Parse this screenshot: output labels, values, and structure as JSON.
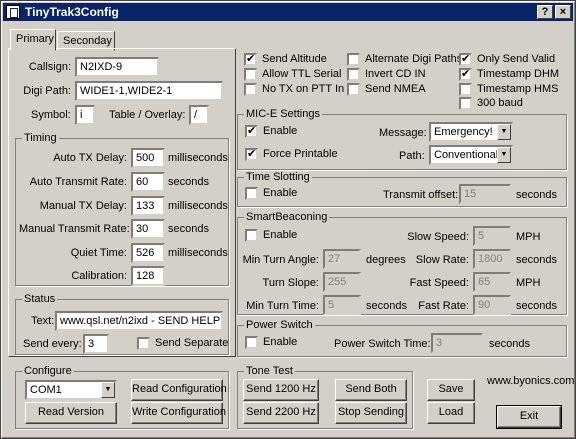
{
  "window": {
    "title": "TinyTrak3Config",
    "help": "?",
    "close": "×"
  },
  "tabs": [
    "Primary",
    "Seconday"
  ],
  "primary": {
    "callsign_label": "Callsign:",
    "callsign": "N2IXD-9",
    "digipath_label": "Digi Path:",
    "digipath": "WIDE1-1,WIDE2-1",
    "symbol_label": "Symbol:",
    "symbol": "i",
    "table_label": "Table / Overlay:",
    "table": "/"
  },
  "timing": {
    "title": "Timing",
    "rows": [
      {
        "label": "Auto TX Delay:",
        "value": "500",
        "unit": "milliseconds"
      },
      {
        "label": "Auto Transmit Rate:",
        "value": "60",
        "unit": "seconds"
      },
      {
        "label": "Manual TX Delay:",
        "value": "133",
        "unit": "milliseconds"
      },
      {
        "label": "Manual Transmit Rate:",
        "value": "30",
        "unit": "seconds"
      },
      {
        "label": "Quiet Time:",
        "value": "526",
        "unit": "milliseconds"
      },
      {
        "label": "Calibration:",
        "value": "128",
        "unit": ""
      }
    ]
  },
  "status": {
    "title": "Status",
    "text_label": "Text:",
    "text": "www.qsl.net/n2ixd - SEND HELP",
    "every_label": "Send every:",
    "every": "3",
    "separate": "Send Separate"
  },
  "checks": [
    {
      "label": "Send Altitude",
      "on": true
    },
    {
      "label": "Alternate Digi Paths",
      "on": false
    },
    {
      "label": "Only Send Valid",
      "on": true
    },
    {
      "label": "Allow TTL Serial",
      "on": false
    },
    {
      "label": "Invert CD IN",
      "on": false
    },
    {
      "label": "Timestamp DHM",
      "on": true
    },
    {
      "label": "No TX on PTT In",
      "on": false
    },
    {
      "label": "Send NMEA",
      "on": false
    },
    {
      "label": "Timestamp HMS",
      "on": false
    },
    {
      "label": "300 baud",
      "on": false
    }
  ],
  "mice": {
    "title": "MIC-E Settings",
    "enable": "Enable",
    "force": "Force Printable",
    "message_label": "Message:",
    "message": "Emergency!",
    "path_label": "Path:",
    "path": "Conventional"
  },
  "slotting": {
    "title": "Time Slotting",
    "enable": "Enable",
    "offset_label": "Transmit offset:",
    "offset": "15",
    "unit": "seconds"
  },
  "smart": {
    "title": "SmartBeaconing",
    "enable": "Enable",
    "slow_speed_label": "Slow Speed:",
    "slow_speed": "5",
    "slow_speed_unit": "MPH",
    "min_turn_angle_label": "Min Turn Angle:",
    "min_turn_angle": "27",
    "min_turn_angle_unit": "degrees",
    "slow_rate_label": "Slow Rate:",
    "slow_rate": "1800",
    "slow_rate_unit": "seconds",
    "turn_slope_label": "Turn Slope:",
    "turn_slope": "255",
    "fast_speed_label": "Fast Speed:",
    "fast_speed": "65",
    "fast_speed_unit": "MPH",
    "min_turn_time_label": "Min Turn Time:",
    "min_turn_time": "5",
    "min_turn_time_unit": "seconds",
    "fast_rate_label": "Fast Rate:",
    "fast_rate": "90",
    "fast_rate_unit": "seconds"
  },
  "power": {
    "title": "Power Switch",
    "enable": "Enable",
    "time_label": "Power Switch Time:",
    "time": "3",
    "unit": "seconds"
  },
  "configure": {
    "title": "Configure",
    "port": "COM1",
    "read_config": "Read Configuration",
    "read_version": "Read Version",
    "write_config": "Write Configuration"
  },
  "tone": {
    "title": "Tone Test",
    "send1200": "Send 1200 Hz",
    "send_both": "Send Both",
    "send2200": "Send 2200 Hz",
    "stop": "Stop Sending"
  },
  "file": {
    "save": "Save",
    "load": "Load",
    "exit": "Exit",
    "website": "www.byonics.com"
  }
}
